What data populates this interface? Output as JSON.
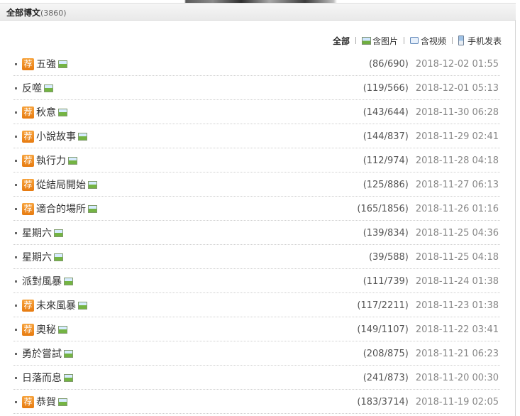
{
  "header": {
    "title": "全部博文",
    "count": "(3860)"
  },
  "filters": [
    {
      "label": "全部",
      "icon": "",
      "active": true
    },
    {
      "label": "含图片",
      "icon": "picture-icon",
      "active": false
    },
    {
      "label": "含视频",
      "icon": "video-icon",
      "active": false
    },
    {
      "label": "手机发表",
      "icon": "phone-icon",
      "active": false
    }
  ],
  "recommend_badge": "荐",
  "posts": [
    {
      "recommended": true,
      "title": "五強",
      "stats": "(86/690)",
      "date": "2018-12-02 01:55"
    },
    {
      "recommended": false,
      "title": "反噬",
      "stats": "(119/566)",
      "date": "2018-12-01 05:13"
    },
    {
      "recommended": true,
      "title": "秋意",
      "stats": "(143/644)",
      "date": "2018-11-30 06:28"
    },
    {
      "recommended": true,
      "title": "小說故事",
      "stats": "(144/837)",
      "date": "2018-11-29 02:41"
    },
    {
      "recommended": true,
      "title": "執行力",
      "stats": "(112/974)",
      "date": "2018-11-28 04:18"
    },
    {
      "recommended": true,
      "title": "從結局開始",
      "stats": "(125/886)",
      "date": "2018-11-27 06:13"
    },
    {
      "recommended": true,
      "title": "適合的場所",
      "stats": "(165/1856)",
      "date": "2018-11-26 01:16"
    },
    {
      "recommended": false,
      "title": "星期六",
      "stats": "(139/834)",
      "date": "2018-11-25 04:36"
    },
    {
      "recommended": false,
      "title": "星期六",
      "stats": "(39/588)",
      "date": "2018-11-25 04:18"
    },
    {
      "recommended": false,
      "title": "派對風暴",
      "stats": "(111/739)",
      "date": "2018-11-24 01:38"
    },
    {
      "recommended": true,
      "title": "未來風暴",
      "stats": "(117/2211)",
      "date": "2018-11-23 01:38"
    },
    {
      "recommended": true,
      "title": "奧秘",
      "stats": "(149/1107)",
      "date": "2018-11-22 03:41"
    },
    {
      "recommended": false,
      "title": "勇於嘗試",
      "stats": "(208/875)",
      "date": "2018-11-21 06:23"
    },
    {
      "recommended": false,
      "title": "日落而息",
      "stats": "(241/873)",
      "date": "2018-11-20 00:30"
    },
    {
      "recommended": true,
      "title": "恭賀",
      "stats": "(183/3714)",
      "date": "2018-11-19 02:05"
    }
  ]
}
